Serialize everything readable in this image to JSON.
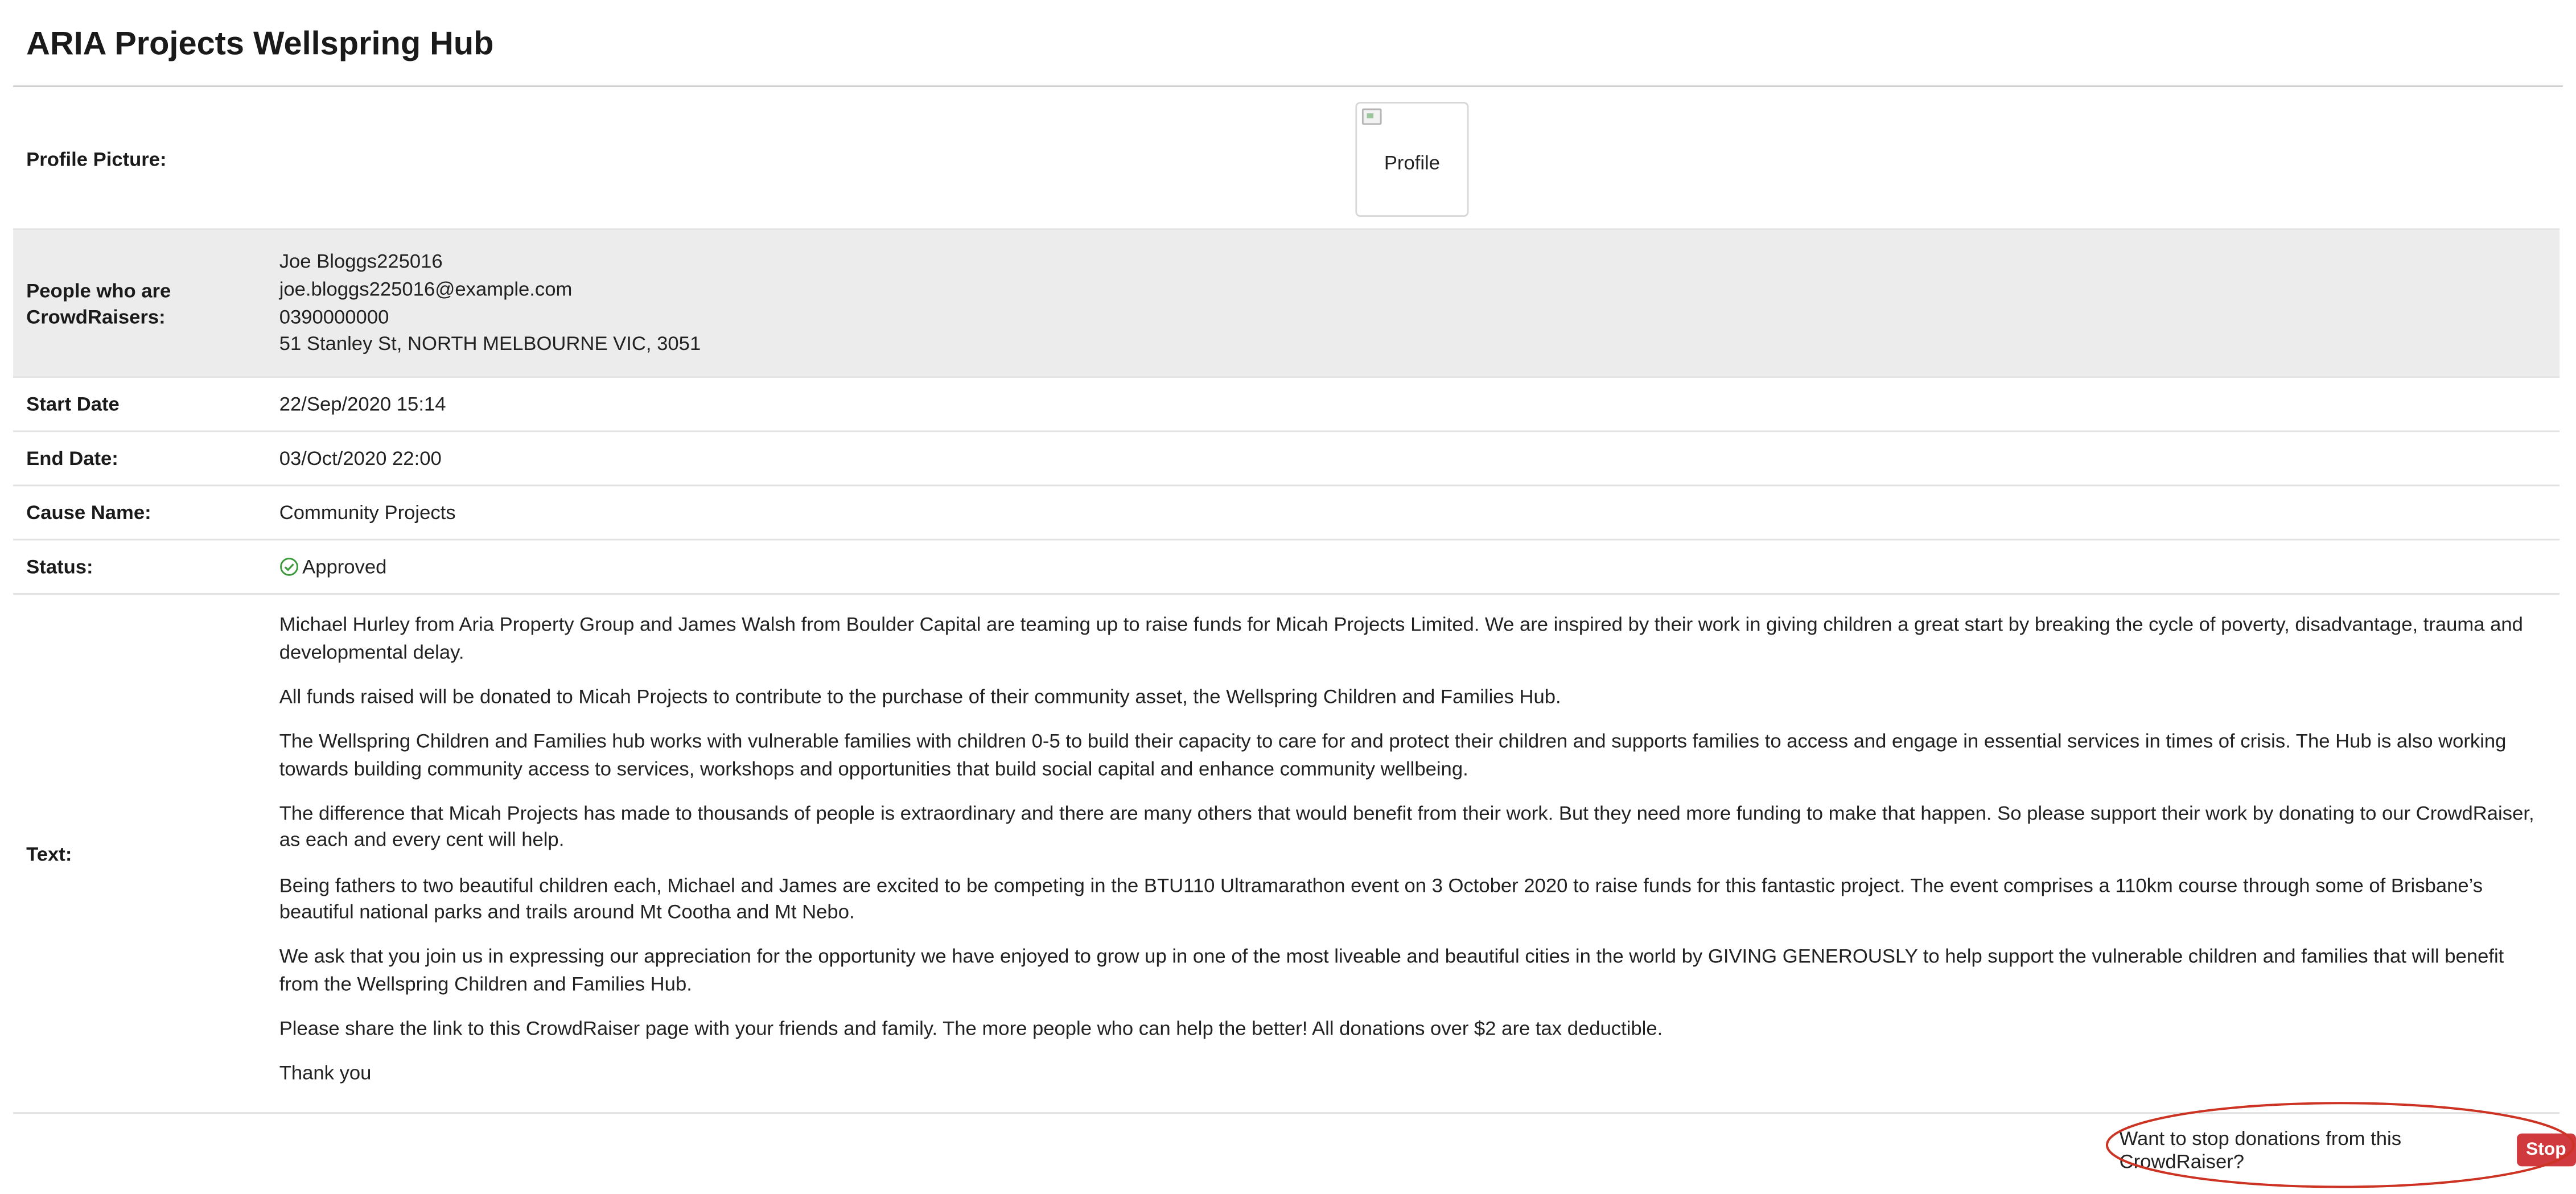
{
  "page": {
    "title": "ARIA Projects Wellspring Hub"
  },
  "profile": {
    "label": "Profile Picture:",
    "image_alt": "Profile"
  },
  "people": {
    "label": "People who are CrowdRaisers:",
    "name": "Joe Bloggs225016",
    "email": "joe.bloggs225016@example.com",
    "phone": "0390000000",
    "address": "51 Stanley St, NORTH MELBOURNE VIC, 3051"
  },
  "start_date": {
    "label": "Start Date",
    "value": "22/Sep/2020 15:14"
  },
  "end_date": {
    "label": "End Date:",
    "value": "03/Oct/2020 22:00"
  },
  "cause": {
    "label": "Cause Name:",
    "value": "Community Projects"
  },
  "status": {
    "label": "Status:",
    "value": "Approved",
    "icon": "check-circle-icon",
    "color": "#3a9a3a"
  },
  "text": {
    "label": "Text:",
    "paragraphs": [
      "Michael Hurley from Aria Property Group and James Walsh from Boulder Capital are teaming up to raise funds for Micah Projects Limited. We are inspired by their work in giving children a great start by breaking the cycle of poverty, disadvantage, trauma and developmental delay.",
      "All funds raised will be donated to Micah Projects to contribute to the purchase of their community asset, the Wellspring Children and Families Hub.",
      "The Wellspring Children and Families hub works with vulnerable families with children 0-5 to build their capacity to care for and protect their children and supports families to access and engage in essential services in times of crisis. The Hub is also working towards building community access to services, workshops and opportunities that build social capital and enhance community wellbeing.",
      "The difference that Micah Projects has made to thousands of people is extraordinary and there are many others that would benefit from their work. But they need more funding to make that happen. So please support their work by donating to our CrowdRaiser, as each and every cent will help.",
      "Being fathers to two beautiful children each, Michael and James are excited to be competing in the BTU110 Ultramarathon event on 3 October 2020 to raise funds for this fantastic project. The event comprises a 110km course through some of Brisbane’s beautiful national parks and trails around Mt Cootha and Mt Nebo.",
      "We ask that you join us in expressing our appreciation for the opportunity we have enjoyed to grow up in one of the most liveable and beautiful cities in the world by GIVING GENEROUSLY to help support the vulnerable children and families that will benefit from the Wellspring Children and Families Hub.",
      "Please share the link to this CrowdRaiser page with your friends and family. The more people who can help the better! All donations over $2 are tax deductible.",
      "Thank you"
    ]
  },
  "stop": {
    "prompt": "Want to stop donations from this CrowdRaiser?",
    "button_label": "Stop",
    "button_color": "#d0393e",
    "highlight_color": "#cc3322"
  }
}
